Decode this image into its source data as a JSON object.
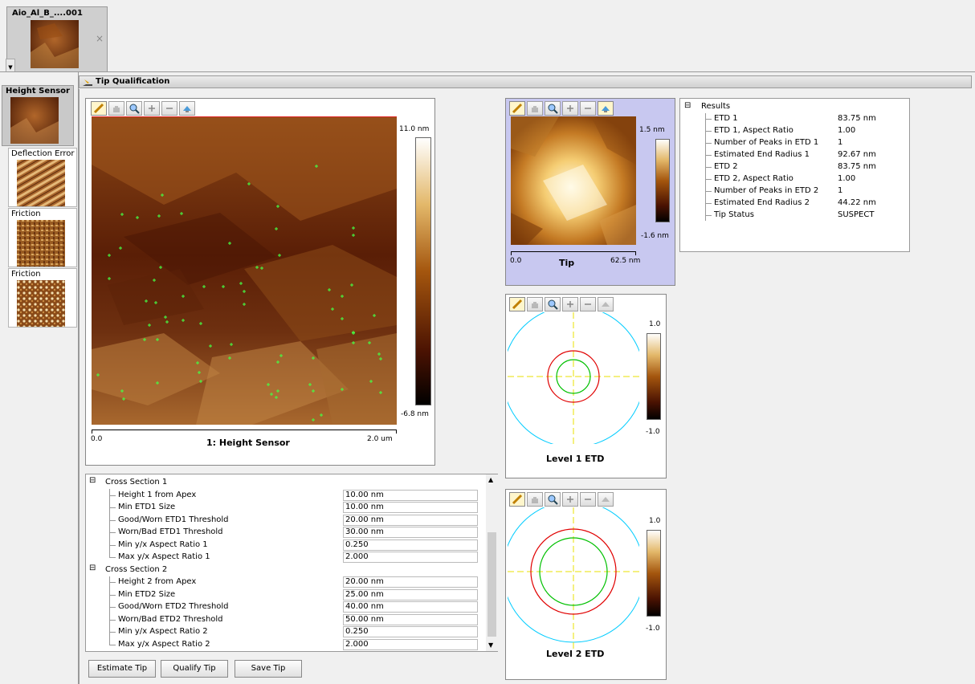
{
  "file_tab": {
    "title": "Aio_Al_B_....001",
    "close": "×"
  },
  "sidebar": {
    "items": [
      {
        "label": "Height Sensor"
      },
      {
        "label": "Deflection Error"
      },
      {
        "label": "Friction"
      },
      {
        "label": "Friction"
      }
    ]
  },
  "window": {
    "title": "Tip Qualification"
  },
  "height_panel": {
    "scale_max": "11.0 nm",
    "scale_min": "-6.8 nm",
    "axis_start": "0.0",
    "axis_end": "2.0 um",
    "caption": "1: Height Sensor"
  },
  "tip_panel": {
    "scale_max": "1.5 nm",
    "scale_min": "-1.6 nm",
    "axis_start": "0.0",
    "axis_end": "62.5 nm",
    "caption": "Tip"
  },
  "etd1_panel": {
    "scale_max": "1.0",
    "scale_min": "-1.0",
    "caption": "Level 1 ETD"
  },
  "etd2_panel": {
    "scale_max": "1.0",
    "scale_min": "-1.0",
    "caption": "Level 2 ETD"
  },
  "results": {
    "title": "Results",
    "expander": "⊟",
    "rows": [
      {
        "key": "ETD 1",
        "value": "83.75 nm"
      },
      {
        "key": "ETD 1, Aspect Ratio",
        "value": "1.00"
      },
      {
        "key": "Number of Peaks in ETD 1",
        "value": "1"
      },
      {
        "key": "Estimated End Radius 1",
        "value": "92.67 nm"
      },
      {
        "key": "ETD 2",
        "value": "83.75 nm"
      },
      {
        "key": "ETD 2, Aspect Ratio",
        "value": "1.00"
      },
      {
        "key": "Number of Peaks in ETD 2",
        "value": "1"
      },
      {
        "key": "Estimated End Radius 2",
        "value": "44.22 nm"
      },
      {
        "key": "Tip Status",
        "value": "SUSPECT"
      }
    ]
  },
  "params": {
    "expander": "⊟",
    "groups": [
      {
        "title": "Cross Section 1",
        "rows": [
          {
            "key": "Height 1 from Apex",
            "value": "10.00 nm"
          },
          {
            "key": "Min ETD1 Size",
            "value": "10.00 nm"
          },
          {
            "key": "Good/Worn ETD1 Threshold",
            "value": "20.00 nm"
          },
          {
            "key": "Worn/Bad ETD1 Threshold",
            "value": "30.00 nm"
          },
          {
            "key": "Min y/x Aspect Ratio 1",
            "value": "0.250"
          },
          {
            "key": "Max y/x Aspect Ratio 1",
            "value": "2.000"
          }
        ]
      },
      {
        "title": "Cross Section 2",
        "rows": [
          {
            "key": "Height 2 from Apex",
            "value": "20.00 nm"
          },
          {
            "key": "Min ETD2 Size",
            "value": "25.00 nm"
          },
          {
            "key": "Good/Worn ETD2 Threshold",
            "value": "40.00 nm"
          },
          {
            "key": "Worn/Bad ETD2 Threshold",
            "value": "50.00 nm"
          },
          {
            "key": "Min y/x Aspect Ratio 2",
            "value": "0.250"
          },
          {
            "key": "Max y/x Aspect Ratio 2",
            "value": "2.000"
          }
        ]
      }
    ]
  },
  "buttons": {
    "estimate": "Estimate Tip",
    "qualify": "Qualify Tip",
    "save": "Save Tip"
  },
  "icons": [
    "ruler-icon",
    "hand-pan-icon",
    "magnifier-icon",
    "zoom-in-icon",
    "zoom-out-icon",
    "tilt-3d-icon"
  ],
  "colors": {
    "tip_panel_bg": "#c8c8f0",
    "etd_outer": "#00ccff",
    "etd_red": "#e00000",
    "etd_green": "#00c000",
    "crosshair": "#e8e000",
    "peak_marker": "#33ff33"
  }
}
